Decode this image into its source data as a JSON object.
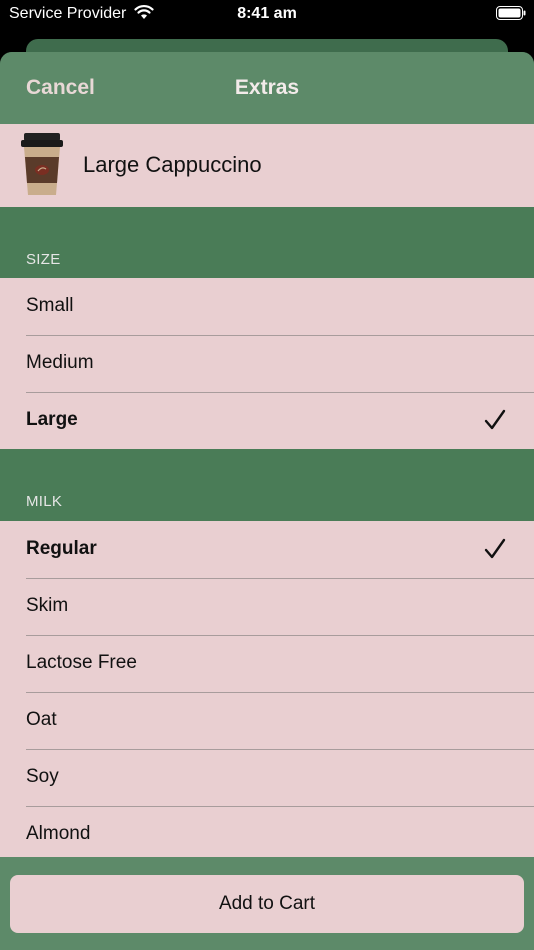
{
  "status_bar": {
    "carrier": "Service Provider",
    "time": "8:41 am"
  },
  "nav": {
    "cancel_label": "Cancel",
    "title": "Extras"
  },
  "product": {
    "name": "Large Cappuccino"
  },
  "size": {
    "header": "SIZE",
    "options": [
      {
        "label": "Small",
        "selected": false
      },
      {
        "label": "Medium",
        "selected": false
      },
      {
        "label": "Large",
        "selected": true
      }
    ]
  },
  "milk": {
    "header": "MILK",
    "options": [
      {
        "label": "Regular",
        "selected": true
      },
      {
        "label": "Skim",
        "selected": false
      },
      {
        "label": "Lactose Free",
        "selected": false
      },
      {
        "label": "Oat",
        "selected": false
      },
      {
        "label": "Soy",
        "selected": false
      },
      {
        "label": "Almond",
        "selected": false
      }
    ]
  },
  "cart": {
    "add_label": "Add to Cart"
  }
}
